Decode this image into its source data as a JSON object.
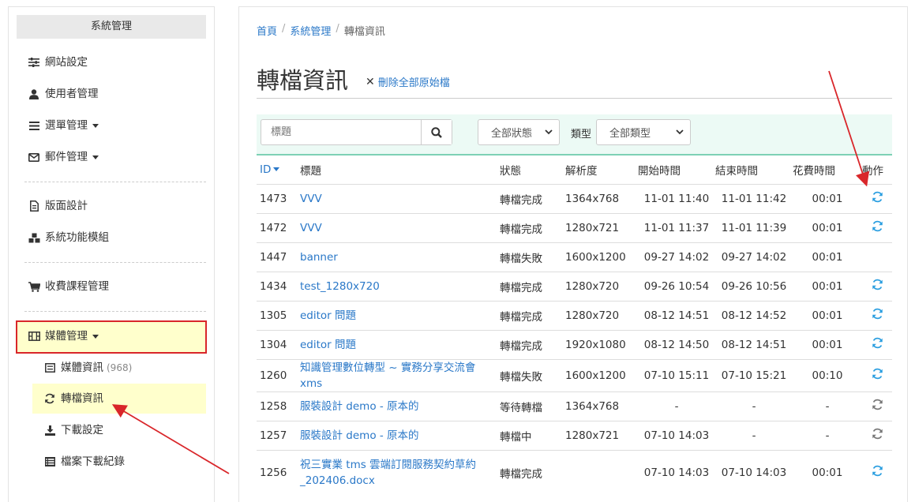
{
  "sidebar": {
    "title": "系統管理",
    "items": [
      {
        "label": "網站設定",
        "icon": "sliders-icon"
      },
      {
        "label": "使用者管理",
        "icon": "user-icon"
      },
      {
        "label": "選單管理",
        "icon": "bars-icon"
      },
      {
        "label": "郵件管理",
        "icon": "envelope-icon"
      },
      {
        "label": "版面設計",
        "icon": "file-icon"
      },
      {
        "label": "系統功能模組",
        "icon": "cubes-icon"
      },
      {
        "label": "收費課程管理",
        "icon": "cart-icon"
      },
      {
        "label": "媒體管理",
        "icon": "film-icon"
      }
    ],
    "sub_items": [
      {
        "label": "媒體資訊",
        "count": "(968)",
        "icon": "list-alt-icon"
      },
      {
        "label": "轉檔資訊",
        "icon": "refresh-icon"
      },
      {
        "label": "下載設定",
        "icon": "download-icon"
      },
      {
        "label": "檔案下載紀錄",
        "icon": "table-icon"
      }
    ]
  },
  "breadcrumb": {
    "home": "首頁",
    "system": "系統管理",
    "current": "轉檔資訊"
  },
  "page": {
    "title": "轉檔資訊",
    "delete_all": "刪除全部原始檔"
  },
  "filters": {
    "search_placeholder": "標題",
    "status_select": "全部狀態",
    "type_label": "類型",
    "type_select": "全部類型"
  },
  "table": {
    "headers": {
      "id": "ID",
      "title": "標題",
      "status": "狀態",
      "resolution": "解析度",
      "start": "開始時間",
      "end": "結束時間",
      "duration": "花費時間",
      "action": "動作"
    },
    "rows": [
      {
        "id": "1473",
        "title": "VVV",
        "status": "轉檔完成",
        "resolution": "1364x768",
        "start": "11-01 11:40",
        "end": "11-01 11:42",
        "duration": "00:01",
        "action": "blue"
      },
      {
        "id": "1472",
        "title": "VVV",
        "status": "轉檔完成",
        "resolution": "1280x721",
        "start": "11-01 11:37",
        "end": "11-01 11:39",
        "duration": "00:01",
        "action": "blue"
      },
      {
        "id": "1447",
        "title": "banner",
        "status": "轉檔失敗",
        "resolution": "1600x1200",
        "start": "09-27 14:02",
        "end": "09-27 14:02",
        "duration": "00:01",
        "action": "none"
      },
      {
        "id": "1434",
        "title": "test_1280x720",
        "status": "轉檔完成",
        "resolution": "1280x720",
        "start": "09-26 10:54",
        "end": "09-26 10:56",
        "duration": "00:01",
        "action": "blue"
      },
      {
        "id": "1305",
        "title": "editor 問題",
        "status": "轉檔完成",
        "resolution": "1280x720",
        "start": "08-12 14:51",
        "end": "08-12 14:52",
        "duration": "00:01",
        "action": "blue"
      },
      {
        "id": "1304",
        "title": "editor 問題",
        "status": "轉檔完成",
        "resolution": "1920x1080",
        "start": "08-12 14:50",
        "end": "08-12 14:51",
        "duration": "00:01",
        "action": "blue"
      },
      {
        "id": "1260",
        "title": "知識管理數位轉型 ~ 實務分享交流會 xms",
        "status": "轉檔失敗",
        "resolution": "1600x1200",
        "start": "07-10 15:11",
        "end": "07-10 15:21",
        "duration": "00:10",
        "action": "blue"
      },
      {
        "id": "1258",
        "title": "服裝設計 demo - 原本的",
        "status": "等待轉檔",
        "resolution": "1364x768",
        "start": "-",
        "end": "-",
        "duration": "-",
        "action": "gray"
      },
      {
        "id": "1257",
        "title": "服裝設計 demo - 原本的",
        "status": "轉檔中",
        "resolution": "1280x721",
        "start": "07-10 14:03",
        "end": "-",
        "duration": "-",
        "action": "gray"
      },
      {
        "id": "1256",
        "title": "祝三實業 tms 雲端訂閱服務契約草約_202406.docx",
        "status": "轉檔完成",
        "resolution": "",
        "start": "07-10 14:03",
        "end": "07-10 14:03",
        "duration": "00:01",
        "action": "blue"
      }
    ]
  },
  "colors": {
    "link": "#2a78c8",
    "highlight": "#ffffcc",
    "annotation": "#d9262a",
    "filter_bg": "#ecfaf5",
    "action_blue": "#2a9ee0",
    "action_gray": "#777777"
  }
}
